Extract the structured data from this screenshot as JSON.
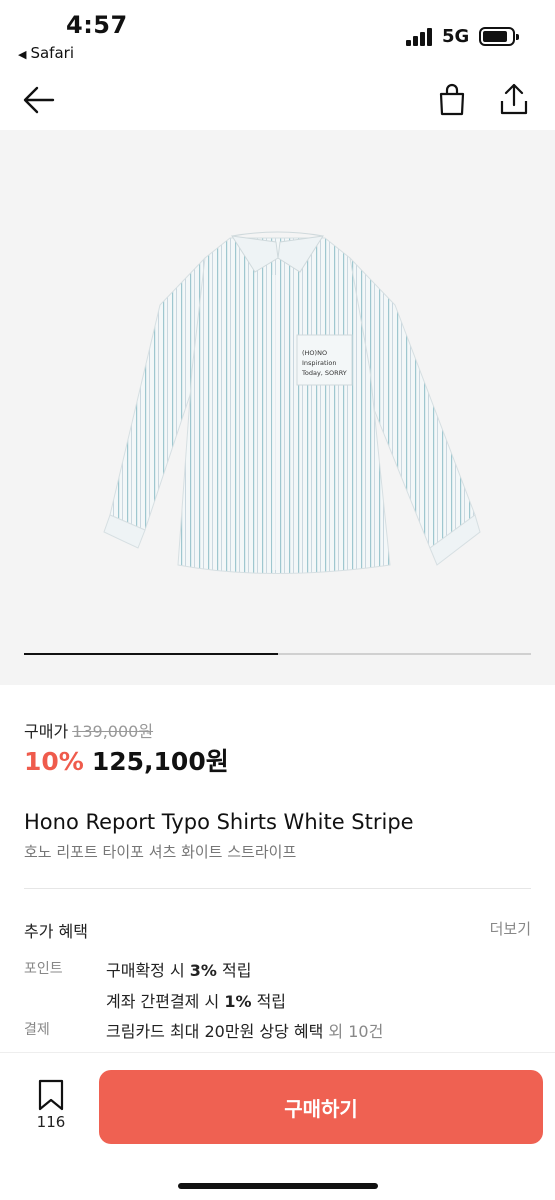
{
  "status_bar": {
    "time": "4:57",
    "back_app": "Safari",
    "network": "5G"
  },
  "nav": {
    "back_icon": "arrow-left-icon",
    "bag_icon": "shopping-bag-icon",
    "share_icon": "share-icon"
  },
  "gallery": {
    "pocket_print": [
      "(HO)NO",
      "Inspiration",
      "Today, SORRY"
    ],
    "progress": 0.5
  },
  "price": {
    "label": "구매가",
    "original": "139,000원",
    "discount": "10%",
    "final": "125,100원"
  },
  "product": {
    "name_en": "Hono Report Typo Shirts White Stripe",
    "name_ko": "호노 리포트 타이포 셔츠 화이트 스트라이프"
  },
  "benefits": {
    "title": "추가 혜택",
    "more": "더보기",
    "point_label": "포인트",
    "point_line1_pre": "구매확정 시 ",
    "point_line1_bold": "3%",
    "point_line1_post": " 적립",
    "point_line2_pre": "계좌 간편결제 시 ",
    "point_line2_bold": "1%",
    "point_line2_post": " 적립",
    "payment_label": "결제",
    "payment_text": "크림카드 최대 20만원 상당 혜택",
    "payment_more": " 외 10건"
  },
  "bottom_bar": {
    "bookmark_count": "116",
    "buy_label": "구매하기"
  },
  "colors": {
    "accent": "#ef6152",
    "discount": "#ef5b4c"
  }
}
